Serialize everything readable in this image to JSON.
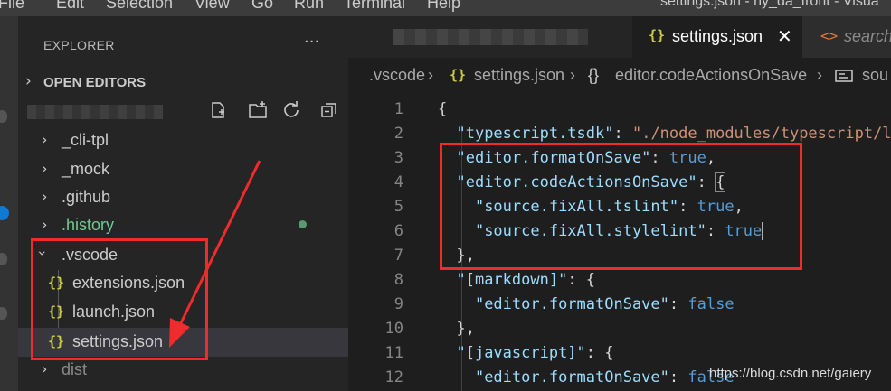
{
  "menubar": {
    "items": [
      "File",
      "Edit",
      "Selection",
      "View",
      "Go",
      "Run",
      "Terminal",
      "Help"
    ],
    "window_title": "settings.json - hy_da_front - Visua"
  },
  "sidebar": {
    "title": "EXPLORER",
    "more_icon": "ellipsis-icon",
    "open_editors_label": "OPEN EDITORS",
    "workspace_actions": [
      "new-file-icon",
      "new-folder-icon",
      "refresh-icon",
      "collapse-all-icon"
    ],
    "tree": [
      {
        "label": "_cli-tpl",
        "type": "folder",
        "expanded": false
      },
      {
        "label": "_mock",
        "type": "folder",
        "expanded": false
      },
      {
        "label": ".github",
        "type": "folder",
        "expanded": false
      },
      {
        "label": ".history",
        "type": "folder",
        "expanded": false,
        "color": "#73c991"
      },
      {
        "label": ".vscode",
        "type": "folder",
        "expanded": true
      },
      {
        "label": "extensions.json",
        "type": "file",
        "icon": "{}"
      },
      {
        "label": "launch.json",
        "type": "file",
        "icon": "{}"
      },
      {
        "label": "settings.json",
        "type": "file",
        "icon": "{}",
        "selected": true
      },
      {
        "label": "dist",
        "type": "folder",
        "expanded": false,
        "color": "#8b8b8b"
      }
    ]
  },
  "tabs": {
    "active": {
      "icon": "{}",
      "label": "settings.json",
      "close": "✕"
    },
    "next": {
      "icon": "<>",
      "label": "search"
    }
  },
  "breadcrumb": {
    "folder": ".vscode",
    "file_icon": "{}",
    "file": "settings.json",
    "symbol_icon": "{}",
    "symbol": "editor.codeActionsOnSave",
    "symbol2_icon": "string-icon",
    "symbol2": "sou"
  },
  "editor": {
    "line_numbers": [
      "1",
      "2",
      "3",
      "4",
      "5",
      "6",
      "7",
      "8",
      "9",
      "10",
      "11",
      "12"
    ],
    "lines": [
      {
        "indent": "",
        "key": "",
        "rest": "{"
      },
      {
        "indent": "  ",
        "key": "\"typescript.tsdk\"",
        "sep": ": ",
        "str": "\"./node_modules/typescript/lib\"",
        "rest": ""
      },
      {
        "indent": "  ",
        "key": "\"editor.formatOnSave\"",
        "sep": ": ",
        "bool": "true",
        "rest": ","
      },
      {
        "indent": "  ",
        "key": "\"editor.codeActionsOnSave\"",
        "sep": ": ",
        "rest": "{"
      },
      {
        "indent": "    ",
        "key": "\"source.fixAll.tslint\"",
        "sep": ": ",
        "bool": "true",
        "rest": ","
      },
      {
        "indent": "    ",
        "key": "\"source.fixAll.stylelint\"",
        "sep": ": ",
        "bool": "true",
        "rest": ""
      },
      {
        "indent": "  ",
        "key": "",
        "rest": "},"
      },
      {
        "indent": "  ",
        "key": "\"[markdown]\"",
        "sep": ": ",
        "rest": "{"
      },
      {
        "indent": "    ",
        "key": "\"editor.formatOnSave\"",
        "sep": ": ",
        "bool": "false",
        "rest": ""
      },
      {
        "indent": "  ",
        "key": "",
        "rest": "},"
      },
      {
        "indent": "  ",
        "key": "\"[javascript]\"",
        "sep": ": ",
        "rest": "{"
      },
      {
        "indent": "    ",
        "key": "\"editor.formatOnSave\"",
        "sep": ": ",
        "bool": "false",
        "rest": ""
      }
    ]
  },
  "watermark": "https://blog.csdn.net/gaiery",
  "colors": {
    "annotation_red": "#ef2b2b",
    "json_icon": "#cbcb41",
    "key": "#9cdcfe",
    "string": "#ce9178",
    "boolean": "#569cd6"
  }
}
